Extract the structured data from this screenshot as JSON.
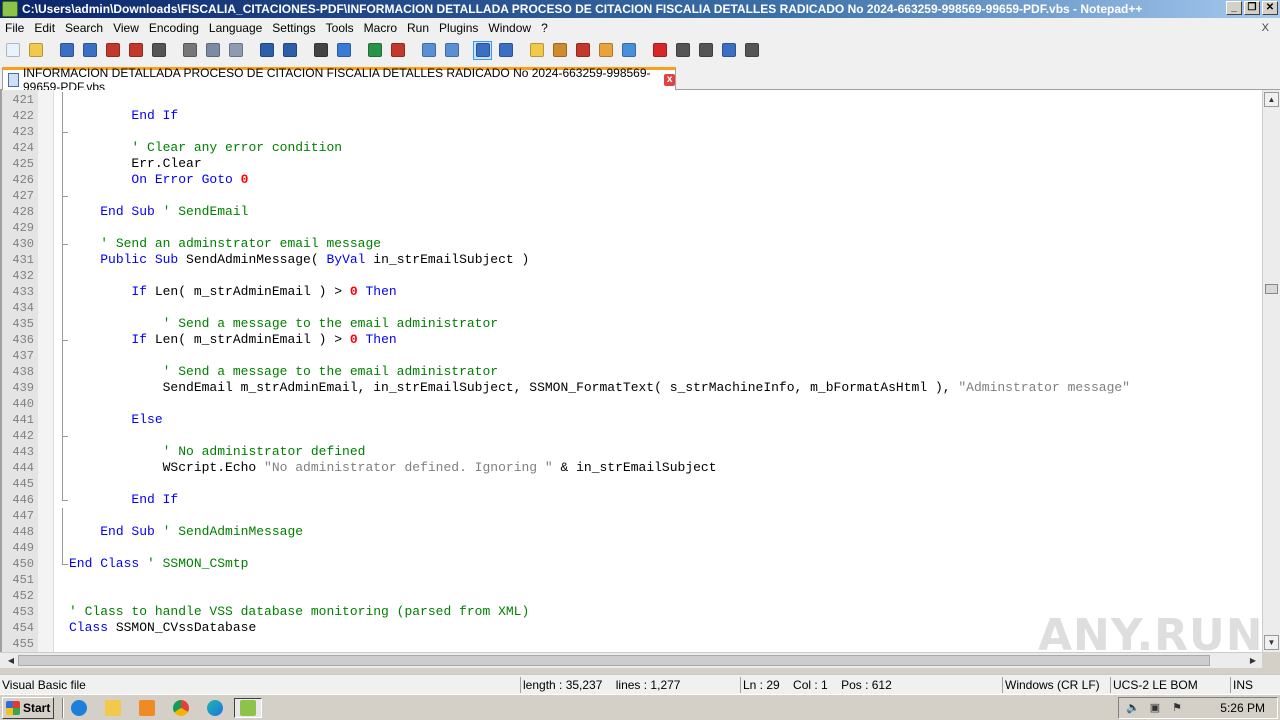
{
  "window": {
    "title": "C:\\Users\\admin\\Downloads\\FISCALIA_CITACIONES-PDF\\INFORMACION DETALLADA PROCESO DE CITACION FISCALIA DETALLES RADICADO No 2024-663259-998569-99659-PDF.vbs - Notepad++",
    "controls": {
      "minimize": "_",
      "restore": "❐",
      "close": "✕"
    }
  },
  "menu": {
    "items": [
      "File",
      "Edit",
      "Search",
      "View",
      "Encoding",
      "Language",
      "Settings",
      "Tools",
      "Macro",
      "Run",
      "Plugins",
      "Window",
      "?"
    ],
    "close_x": "X"
  },
  "toolbar": {
    "buttons": [
      "new-file",
      "open-file",
      "save",
      "save-all",
      "close",
      "close-all",
      "print",
      "cut",
      "copy",
      "paste",
      "undo",
      "redo",
      "find",
      "replace",
      "zoom-in",
      "zoom-out",
      "sync-vertical",
      "sync-horizontal",
      "word-wrap",
      "show-all-chars",
      "indent-guide",
      "doc-map",
      "function-list",
      "folder-as-workspace",
      "monitoring",
      "record-macro",
      "stop-record",
      "play-macro",
      "run-macro-multiple",
      "save-macro"
    ]
  },
  "tab": {
    "label": "INFORMACION DETALLADA PROCESO DE CITACION FISCALIA DETALLES RADICADO No 2024-663259-998569-99659-PDF.vbs",
    "close": "x"
  },
  "editor": {
    "lines": [
      {
        "n": "421",
        "fold": "bar",
        "parts": []
      },
      {
        "n": "422",
        "fold": "bar",
        "parts": [
          [
            "        ",
            ""
          ],
          [
            "End If",
            "kw"
          ]
        ]
      },
      {
        "n": "423",
        "fold": "tick",
        "parts": []
      },
      {
        "n": "424",
        "fold": "bar",
        "parts": [
          [
            "        ",
            ""
          ],
          [
            "' Clear any error condition",
            "cm"
          ]
        ]
      },
      {
        "n": "425",
        "fold": "bar",
        "parts": [
          [
            "        Err.Clear",
            ""
          ]
        ]
      },
      {
        "n": "426",
        "fold": "bar",
        "parts": [
          [
            "        ",
            ""
          ],
          [
            "On Error Goto",
            "kw"
          ],
          [
            " ",
            ""
          ],
          [
            "0",
            "num"
          ]
        ]
      },
      {
        "n": "427",
        "fold": "tick",
        "parts": []
      },
      {
        "n": "428",
        "fold": "bar",
        "parts": [
          [
            "    ",
            ""
          ],
          [
            "End Sub",
            "kw"
          ],
          [
            " ",
            ""
          ],
          [
            "' SendEmail",
            "cm"
          ]
        ]
      },
      {
        "n": "429",
        "fold": "bar",
        "parts": []
      },
      {
        "n": "430",
        "fold": "tick",
        "parts": [
          [
            "    ",
            ""
          ],
          [
            "' Send an adminstrator email message",
            "cm"
          ]
        ]
      },
      {
        "n": "431",
        "fold": "bar",
        "parts": [
          [
            "    ",
            ""
          ],
          [
            "Public Sub",
            "kw"
          ],
          [
            " SendAdminMessage( ",
            ""
          ],
          [
            "ByVal",
            "kw"
          ],
          [
            " in_strEmailSubject )",
            ""
          ]
        ]
      },
      {
        "n": "432",
        "fold": "bar",
        "parts": []
      },
      {
        "n": "433",
        "fold": "bar",
        "parts": [
          [
            "        ",
            ""
          ],
          [
            "If",
            "kw"
          ],
          [
            " Len( m_strAdminEmail ) > ",
            ""
          ],
          [
            "0",
            "num"
          ],
          [
            " ",
            ""
          ],
          [
            "Then",
            "kw"
          ]
        ]
      },
      {
        "n": "434",
        "fold": "bar",
        "parts": []
      },
      {
        "n": "435",
        "fold": "bar",
        "parts": [
          [
            "            ",
            ""
          ],
          [
            "' Send a message to the email administrator",
            "cm"
          ]
        ]
      },
      {
        "n": "436",
        "fold": "tick",
        "parts": [
          [
            "        ",
            ""
          ],
          [
            "If",
            "kw"
          ],
          [
            " Len( m_strAdminEmail ) > ",
            ""
          ],
          [
            "0",
            "num"
          ],
          [
            " ",
            ""
          ],
          [
            "Then",
            "kw"
          ]
        ]
      },
      {
        "n": "437",
        "fold": "bar",
        "parts": []
      },
      {
        "n": "438",
        "fold": "bar",
        "parts": [
          [
            "            ",
            ""
          ],
          [
            "' Send a message to the email administrator",
            "cm"
          ]
        ]
      },
      {
        "n": "439",
        "fold": "bar",
        "parts": [
          [
            "            SendEmail m_strAdminEmail, in_strEmailSubject, SSMON_FormatText( s_strMachineInfo, m_bFormatAsHtml ), ",
            ""
          ],
          [
            "\"Adminstrator message\"",
            "str"
          ]
        ]
      },
      {
        "n": "440",
        "fold": "bar",
        "parts": []
      },
      {
        "n": "441",
        "fold": "bar",
        "parts": [
          [
            "        ",
            ""
          ],
          [
            "Else",
            "kw"
          ]
        ]
      },
      {
        "n": "442",
        "fold": "tick",
        "parts": []
      },
      {
        "n": "443",
        "fold": "bar",
        "parts": [
          [
            "            ",
            ""
          ],
          [
            "' No administrator defined",
            "cm"
          ]
        ]
      },
      {
        "n": "444",
        "fold": "bar",
        "parts": [
          [
            "            WScript.Echo ",
            ""
          ],
          [
            "\"No administrator defined. Ignoring \"",
            "str"
          ],
          [
            " & in_strEmailSubject",
            ""
          ]
        ]
      },
      {
        "n": "445",
        "fold": "bar",
        "parts": []
      },
      {
        "n": "446",
        "fold": "end",
        "parts": [
          [
            "        ",
            ""
          ],
          [
            "End If",
            "kw"
          ]
        ]
      },
      {
        "n": "447",
        "fold": "bar",
        "parts": []
      },
      {
        "n": "448",
        "fold": "bar",
        "parts": [
          [
            "    ",
            ""
          ],
          [
            "End Sub",
            "kw"
          ],
          [
            " ",
            ""
          ],
          [
            "' SendAdminMessage",
            "cm"
          ]
        ]
      },
      {
        "n": "449",
        "fold": "bar",
        "parts": []
      },
      {
        "n": "450",
        "fold": "end",
        "parts": [
          [
            "",
            ""
          ],
          [
            "End Class",
            "kw"
          ],
          [
            " ",
            ""
          ],
          [
            "' SSMON_CSmtp",
            "cm"
          ]
        ]
      },
      {
        "n": "451",
        "fold": "",
        "parts": []
      },
      {
        "n": "452",
        "fold": "",
        "parts": []
      },
      {
        "n": "453",
        "fold": "",
        "parts": [
          [
            "",
            ""
          ],
          [
            "' Class to handle VSS database monitoring (parsed from XML)",
            "cm"
          ]
        ]
      },
      {
        "n": "454",
        "fold": "",
        "parts": [
          [
            "",
            ""
          ],
          [
            "Class",
            "kw"
          ],
          [
            " SSMON_CVssDatabase",
            ""
          ]
        ]
      },
      {
        "n": "455",
        "fold": "",
        "parts": []
      }
    ]
  },
  "watermark": "ANY.RUN",
  "status": {
    "file_type": "Visual Basic file",
    "length": "length : 35,237",
    "lines": "lines : 1,277",
    "ln": "Ln : 29",
    "col": "Col : 1",
    "pos": "Pos : 612",
    "eol": "Windows (CR LF)",
    "encoding": "UCS-2 LE BOM",
    "mode": "INS"
  },
  "taskbar": {
    "start_label": "Start",
    "clock": "5:26 PM"
  }
}
